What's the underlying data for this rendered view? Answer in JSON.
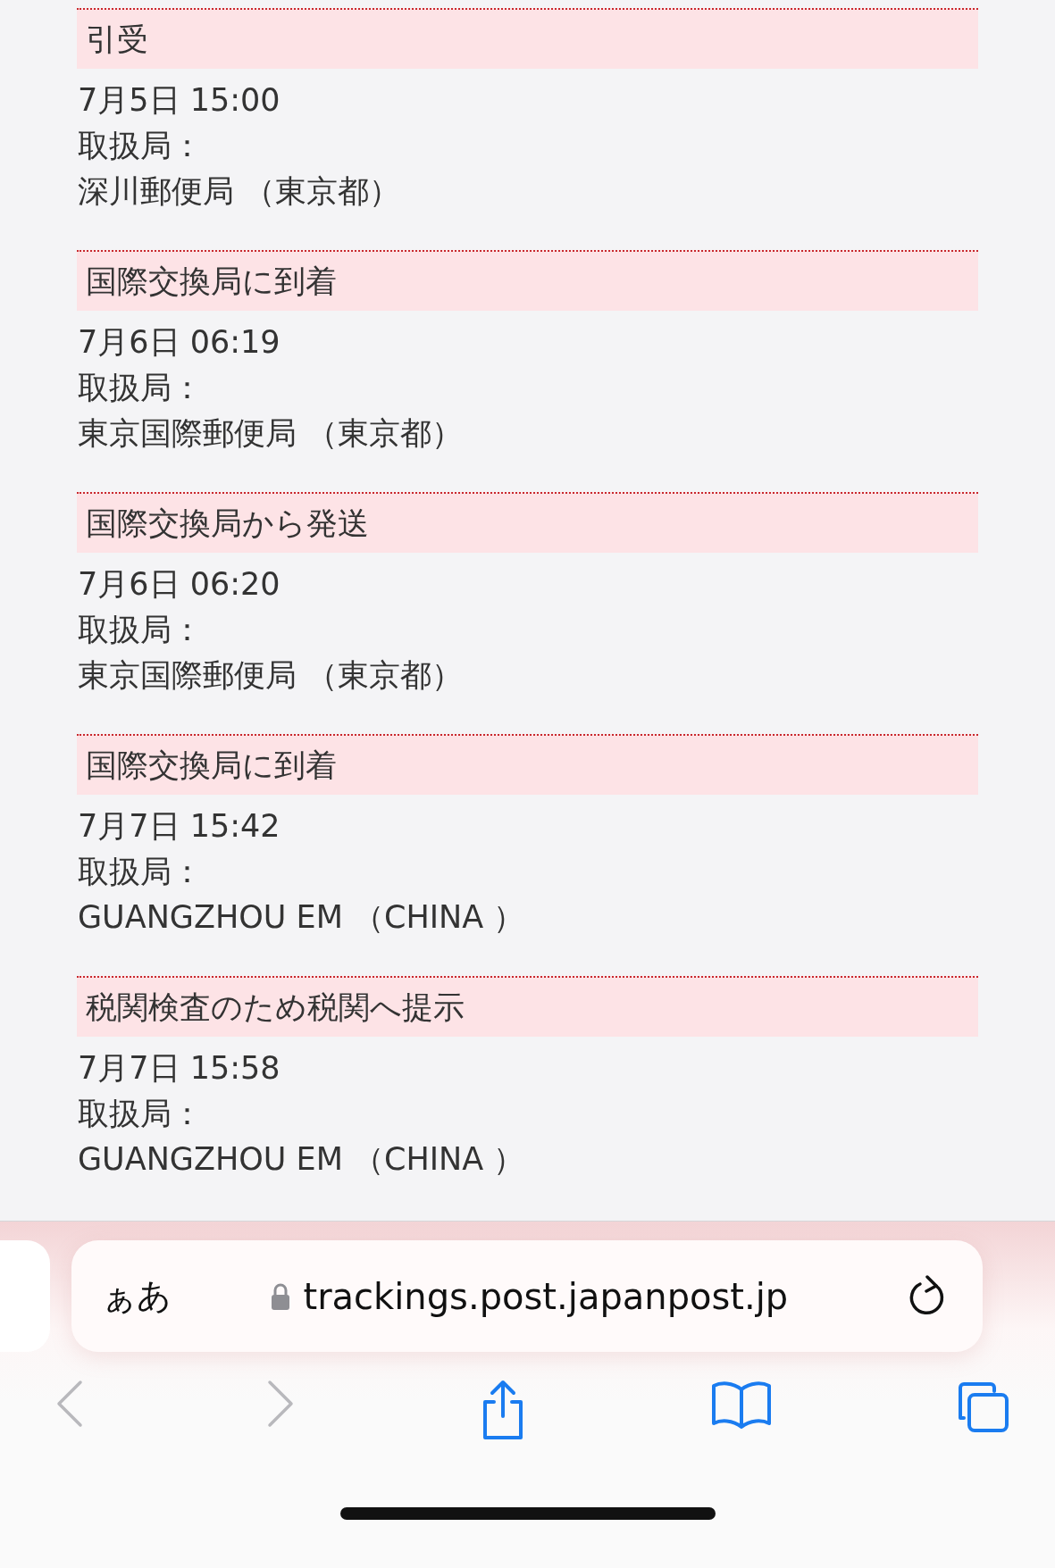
{
  "events": [
    {
      "status": "引受",
      "datetime": "7月5日 15:00",
      "office_label": "取扱局：",
      "office": "深川郵便局 （東京都）"
    },
    {
      "status": "国際交換局に到着",
      "datetime": "7月6日 06:19",
      "office_label": "取扱局：",
      "office": "東京国際郵便局 （東京都）"
    },
    {
      "status": "国際交換局から発送",
      "datetime": "7月6日 06:20",
      "office_label": "取扱局：",
      "office": "東京国際郵便局 （東京都）"
    },
    {
      "status": "国際交換局に到着",
      "datetime": "7月7日 15:42",
      "office_label": "取扱局：",
      "office": "GUANGZHOU EM （CHINA ）"
    },
    {
      "status": "税関検査のため税関へ提示",
      "datetime": "7月7日 15:58",
      "office_label": "取扱局：",
      "office": "GUANGZHOU EM （CHINA ）"
    }
  ],
  "address_bar": {
    "text_size_button": "ぁあ",
    "url": "trackings.post.japanpost.jp",
    "secure": true
  },
  "toolbar": [
    {
      "kind": "back",
      "disabled": true
    },
    {
      "kind": "forward",
      "disabled": true
    },
    {
      "kind": "share",
      "disabled": false
    },
    {
      "kind": "bookmarks",
      "disabled": false
    },
    {
      "kind": "tabs",
      "disabled": false
    }
  ]
}
